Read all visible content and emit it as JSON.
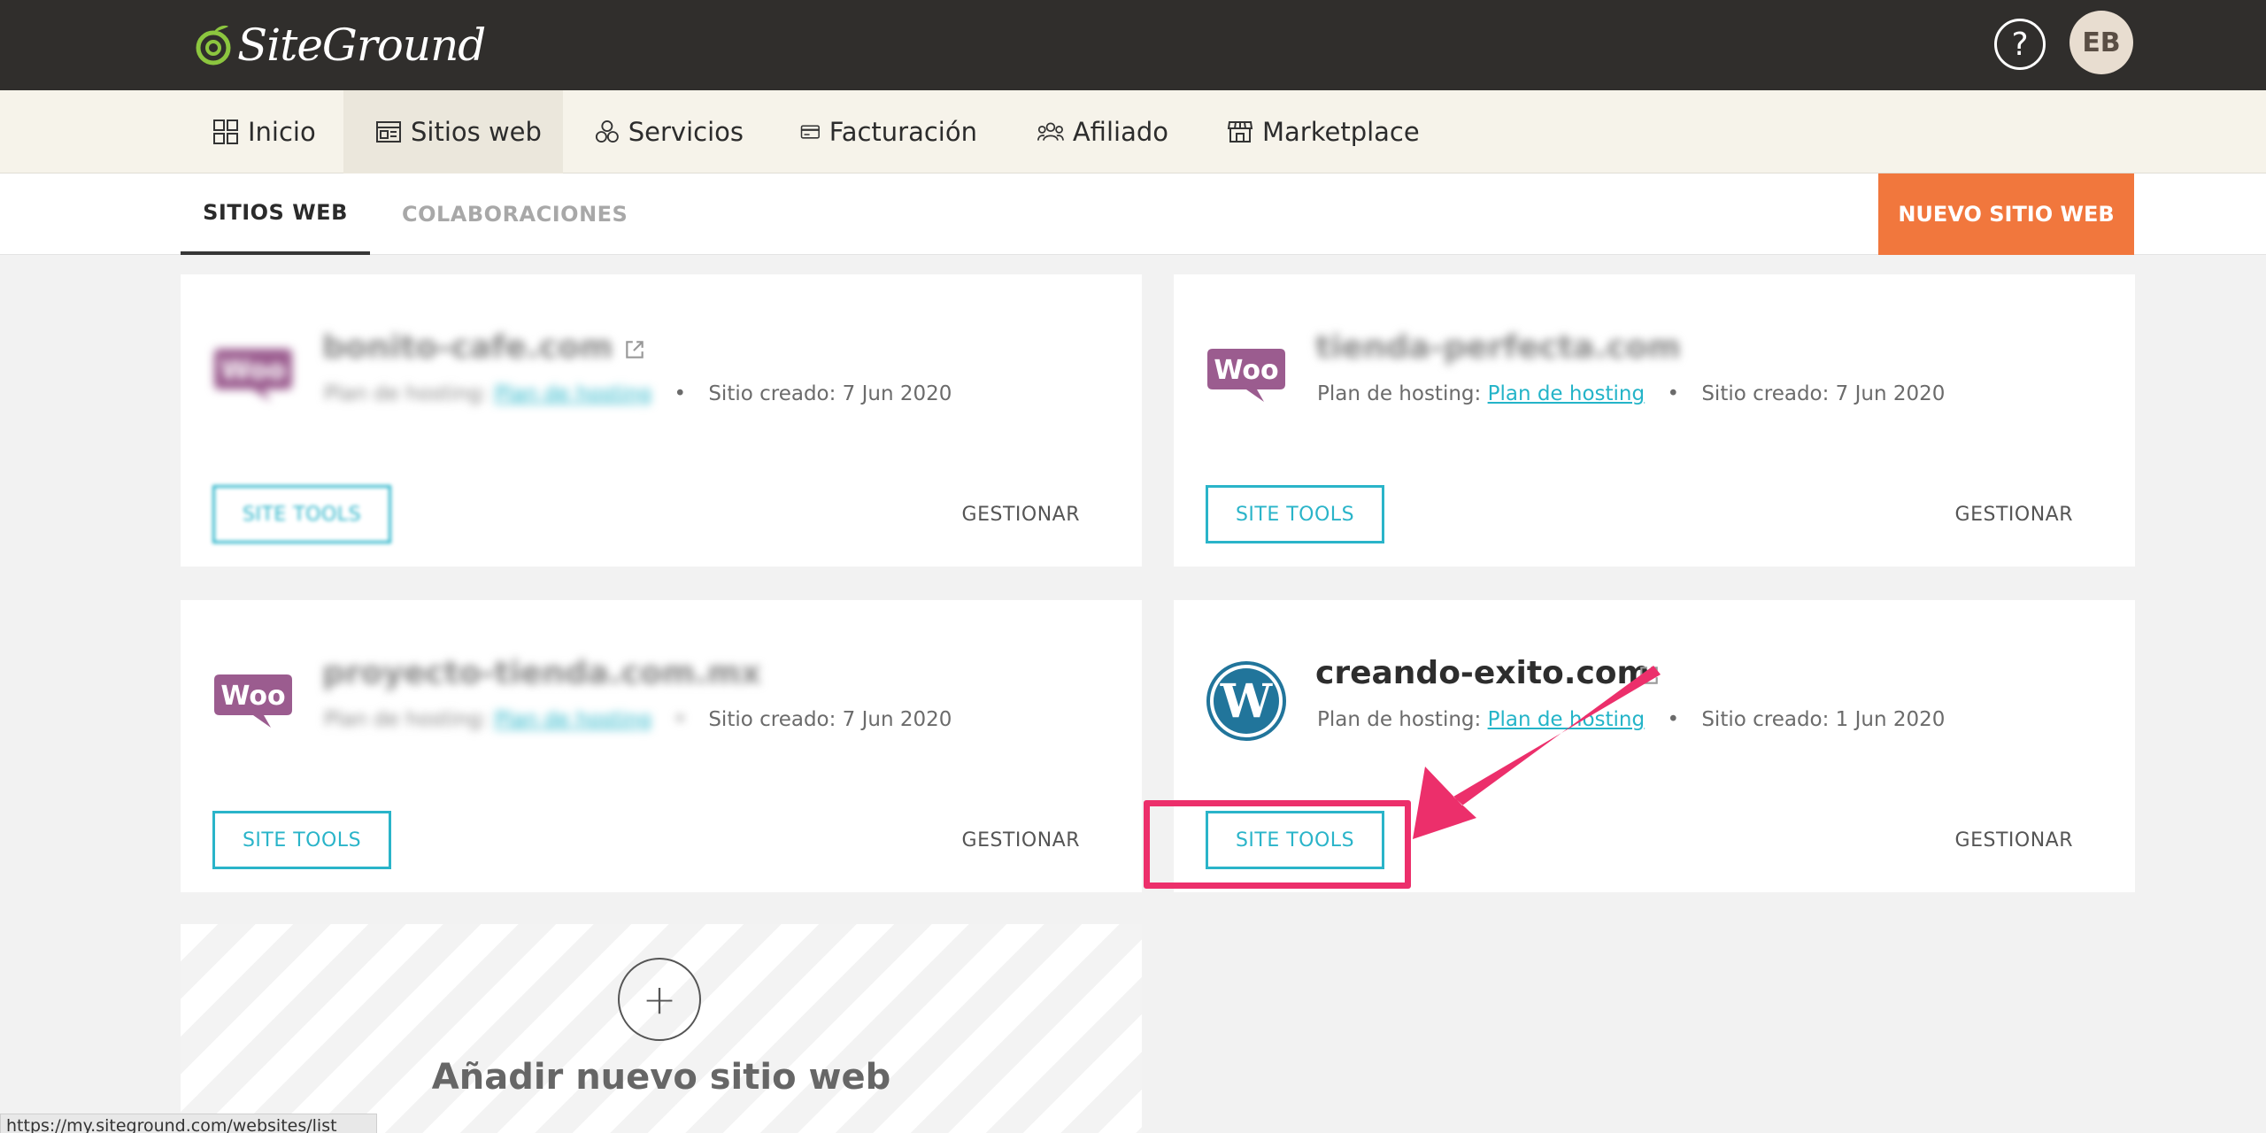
{
  "header": {
    "logo_text": "SiteGround",
    "help_label": "?",
    "avatar_initials": "EB"
  },
  "main_nav": {
    "items": [
      {
        "label": "Inicio",
        "icon": "grid-icon"
      },
      {
        "label": "Sitios web",
        "icon": "website-icon",
        "active": true
      },
      {
        "label": "Servicios",
        "icon": "services-icon"
      },
      {
        "label": "Facturación",
        "icon": "credit-card-icon"
      },
      {
        "label": "Afiliado",
        "icon": "affiliate-icon"
      },
      {
        "label": "Marketplace",
        "icon": "store-icon"
      }
    ]
  },
  "sub_nav": {
    "tabs": [
      {
        "label": "SITIOS WEB",
        "active": true
      },
      {
        "label": "COLABORACIONES",
        "active": false
      }
    ],
    "new_site_label": "NUEVO SITIO WEB"
  },
  "sites": [
    {
      "name": "bonito-cafe.com",
      "logo": "woo-logo",
      "plan_label": "Plan de hosting:",
      "plan_link": "Plan de hosting",
      "created": "Sitio creado: 7 Jun 2020",
      "tools_label": "SITE TOOLS",
      "manage_label": "GESTIONAR",
      "blurred": true
    },
    {
      "name": "tienda-perfecta.com",
      "logo": "woo-logo",
      "plan_label": "Plan de hosting:",
      "plan_link": "Plan de hosting",
      "created": "Sitio creado: 7 Jun 2020",
      "tools_label": "SITE TOOLS",
      "manage_label": "GESTIONAR",
      "blurred": true
    },
    {
      "name": "proyecto-tienda.com.mx",
      "logo": "woo-logo",
      "plan_label": "Plan de hosting:",
      "plan_link": "Plan de hosting",
      "created": "Sitio creado: 7 Jun 2020",
      "tools_label": "SITE TOOLS",
      "manage_label": "GESTIONAR",
      "blurred": true
    },
    {
      "name": "creando-exito.com",
      "logo": "wordpress-logo",
      "plan_label": "Plan de hosting:",
      "plan_link": "Plan de hosting",
      "created": "Sitio creado: 1 Jun 2020",
      "tools_label": "SITE TOOLS",
      "manage_label": "GESTIONAR",
      "blurred": false
    }
  ],
  "add_site": {
    "plus": "+",
    "label": "Añadir nuevo sitio web"
  },
  "status_url": "https://my.siteground.com/websites/list",
  "colors": {
    "header_bg": "#302e2c",
    "accent_orange": "#f1773d",
    "accent_teal": "#2ab4c9",
    "annotation_pink": "#ec2f6b"
  }
}
